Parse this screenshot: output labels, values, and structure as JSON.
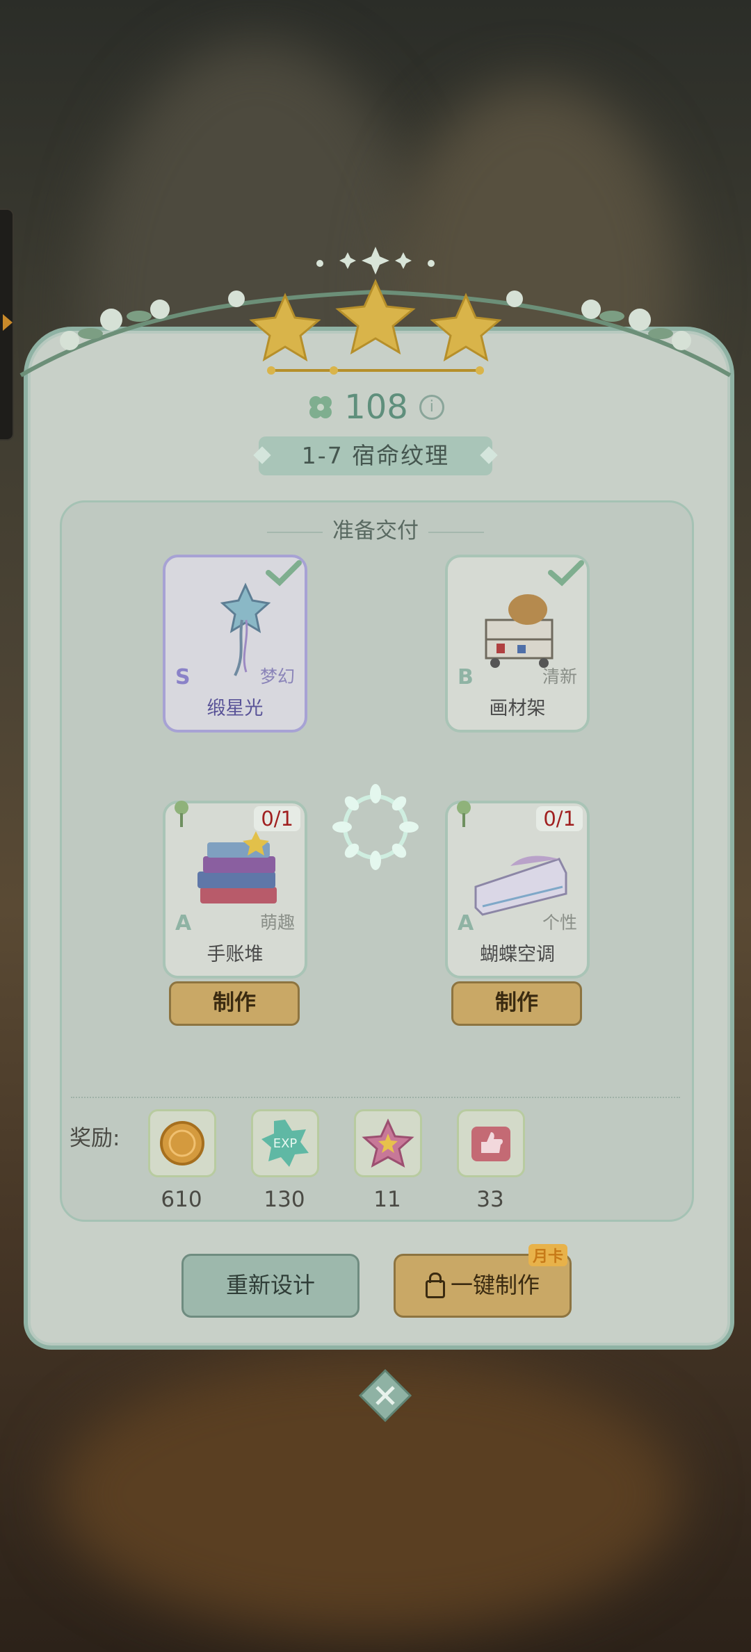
{
  "level": {
    "score": "108",
    "info_icon": "i",
    "title": "1-7  宿命纹理"
  },
  "section_title": "准备交付",
  "cards": [
    {
      "name": "缎星光",
      "grade": "S",
      "style": "梦幻",
      "status": "done"
    },
    {
      "name": "画材架",
      "grade": "B",
      "style": "清新",
      "status": "done"
    },
    {
      "name": "手账堆",
      "grade": "A",
      "style": "萌趣",
      "count": "0/1"
    },
    {
      "name": "蝴蝶空调",
      "grade": "A",
      "style": "个性",
      "count": "0/1"
    }
  ],
  "make_label": "制作",
  "rewards": {
    "label": "奖励:",
    "items": [
      {
        "icon": "coin-icon",
        "value": "610"
      },
      {
        "icon": "exp-icon",
        "value": "130"
      },
      {
        "icon": "star-icon",
        "value": "11"
      },
      {
        "icon": "thumbs-up-icon",
        "value": "33"
      }
    ]
  },
  "buttons": {
    "redesign": "重新设计",
    "one_click": "一键制作",
    "month_card": "月卡"
  },
  "colors": {
    "accent_green": "#8fb2a4",
    "button_gold": "#c9a866",
    "count_red": "#a02020"
  }
}
